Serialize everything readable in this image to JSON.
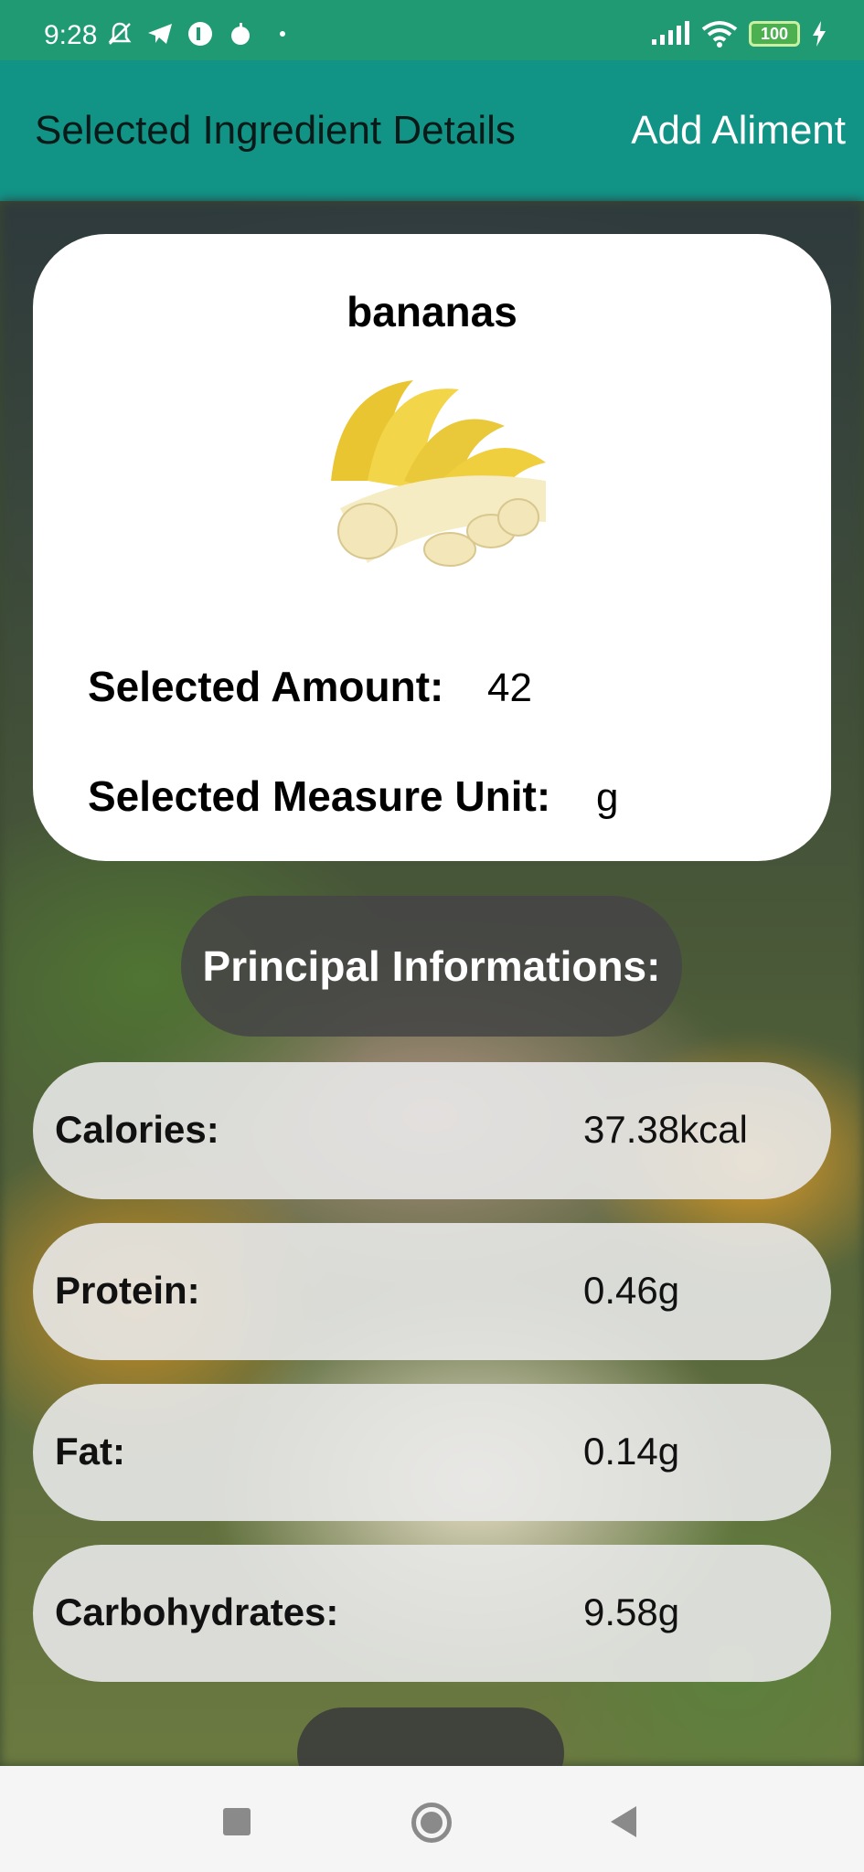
{
  "status_bar": {
    "time": "9:28",
    "battery": "100",
    "icons": [
      "mute-icon",
      "telegram-icon",
      "app-icon",
      "apple-icon",
      "dot-icon",
      "signal-icon",
      "wifi-icon",
      "battery-icon",
      "charging-icon"
    ]
  },
  "app_bar": {
    "title": "Selected Ingredient Details",
    "action": "Add Aliment"
  },
  "ingredient": {
    "name": "bananas",
    "amount_label": "Selected Amount:",
    "amount_value": "42",
    "unit_label": "Selected Measure Unit:",
    "unit_value": "g"
  },
  "section_header": "Principal Informations:",
  "nutrition": [
    {
      "label": "Calories:",
      "value": "37.38kcal"
    },
    {
      "label": "Protein:",
      "value": "0.46g"
    },
    {
      "label": "Fat:",
      "value": "0.14g"
    },
    {
      "label": "Carbohydrates:",
      "value": "9.58g"
    }
  ],
  "colors": {
    "status_bar": "#1f9a72",
    "app_bar": "#119486",
    "card": "#ffffff",
    "pill": "#464646"
  }
}
